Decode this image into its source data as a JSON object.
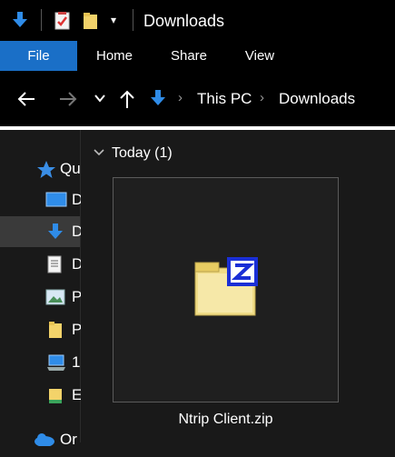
{
  "window": {
    "title": "Downloads"
  },
  "ribbon": {
    "tabs": [
      "File",
      "Home",
      "Share",
      "View"
    ]
  },
  "address": {
    "segments": [
      "This PC",
      "Downloads"
    ]
  },
  "nav": {
    "items": [
      {
        "label": "Qu",
        "icon": "star-icon"
      },
      {
        "label": "D",
        "icon": "desktop-icon"
      },
      {
        "label": "D",
        "icon": "download-icon",
        "selected": true
      },
      {
        "label": "D",
        "icon": "document-icon"
      },
      {
        "label": "P",
        "icon": "pictures-icon"
      },
      {
        "label": "P",
        "icon": "folder-icon"
      },
      {
        "label": "1",
        "icon": "computer-icon"
      },
      {
        "label": "E",
        "icon": "folder-icon"
      },
      {
        "label": "Or",
        "icon": "cloud-icon"
      }
    ]
  },
  "content": {
    "group": {
      "label": "Today (1)"
    },
    "files": [
      {
        "name": "Ntrip Client.zip",
        "icon": "zip-folder-icon"
      }
    ]
  },
  "colors": {
    "accent": "#1a6fc7",
    "background": "#191919",
    "chrome": "#000000"
  }
}
